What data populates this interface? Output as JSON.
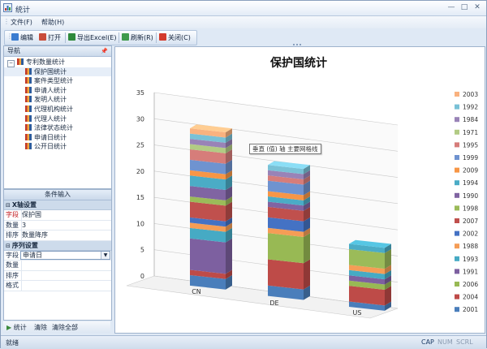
{
  "window": {
    "title": "统计"
  },
  "menu": {
    "items": [
      "文件(F)",
      "帮助(H)"
    ]
  },
  "toolbar": {
    "edit": "编辑",
    "open": "打开",
    "export": "导出Excel(E)",
    "refresh": "刷新(R)",
    "close": "关闭(C)"
  },
  "nav": {
    "title": "导航",
    "root": "专利数量统计",
    "items": [
      "保护国统计",
      "案件类型统计",
      "申请人统计",
      "发明人统计",
      "代理机构统计",
      "代理人统计",
      "法律状态统计",
      "申请日统计",
      "公开日统计"
    ]
  },
  "conditions": {
    "title": "条件输入",
    "x_axis": {
      "title": "X轴设置",
      "field_label": "字段",
      "field_value": "保护国",
      "count_label": "数量",
      "count_value": "3",
      "sort_label": "排序",
      "sort_value": "数量降序"
    },
    "series": {
      "title": "序列设置",
      "field_label": "字段",
      "field_value": "申请日",
      "count_label": "数量",
      "sort_label": "排序",
      "format_label": "格式"
    }
  },
  "actions": {
    "stat": "统计",
    "clear": "清除",
    "clear_all": "清除全部"
  },
  "status": {
    "text": "就绪",
    "cap": "CAP",
    "num": "NUM",
    "scrl": "SCRL"
  },
  "tooltip": "垂直 (值) 轴 主要网格线",
  "chart_data": {
    "type": "bar",
    "stacked": true,
    "three_d": true,
    "title": "保护国统计",
    "categories": [
      "CN",
      "DE",
      "US"
    ],
    "ylim": [
      0,
      35
    ],
    "yticks": [
      0,
      5,
      10,
      15,
      20,
      25,
      30,
      35
    ],
    "grid": true,
    "legend_position": "right",
    "series": [
      {
        "name": "2001",
        "color": "#4a7ebb",
        "values": [
          2,
          2,
          1
        ]
      },
      {
        "name": "2004",
        "color": "#be4b48",
        "values": [
          1,
          5,
          3
        ]
      },
      {
        "name": "2006",
        "color": "#98b954",
        "values": [
          0,
          5,
          1
        ]
      },
      {
        "name": "1991",
        "color": "#7d60a0",
        "values": [
          6,
          0,
          1
        ]
      },
      {
        "name": "1993",
        "color": "#46aac4",
        "values": [
          2,
          0,
          1
        ]
      },
      {
        "name": "1988",
        "color": "#f59d56",
        "values": [
          1,
          1,
          1
        ]
      },
      {
        "name": "2002",
        "color": "#4472c4",
        "values": [
          1,
          2,
          0
        ]
      },
      {
        "name": "2007",
        "color": "#c0504d",
        "values": [
          3,
          2,
          0
        ]
      },
      {
        "name": "1998",
        "color": "#9bbb59",
        "values": [
          1,
          0,
          3
        ]
      },
      {
        "name": "1990",
        "color": "#8064a2",
        "values": [
          2,
          1,
          0
        ]
      },
      {
        "name": "1994",
        "color": "#4bacc6",
        "values": [
          2,
          1,
          1
        ]
      },
      {
        "name": "2009",
        "color": "#f79646",
        "values": [
          1,
          1,
          0
        ]
      },
      {
        "name": "1999",
        "color": "#6f93d0",
        "values": [
          2,
          2,
          0
        ]
      },
      {
        "name": "1995",
        "color": "#d67d7a",
        "values": [
          2,
          1,
          0
        ]
      },
      {
        "name": "1971",
        "color": "#b2cb84",
        "values": [
          1,
          0,
          0
        ]
      },
      {
        "name": "1984",
        "color": "#9983b7",
        "values": [
          1,
          1,
          0
        ]
      },
      {
        "name": "1992",
        "color": "#79c1d6",
        "values": [
          1,
          1,
          0
        ]
      },
      {
        "name": "2003",
        "color": "#f9b27f",
        "values": [
          1,
          0,
          0
        ]
      }
    ]
  }
}
